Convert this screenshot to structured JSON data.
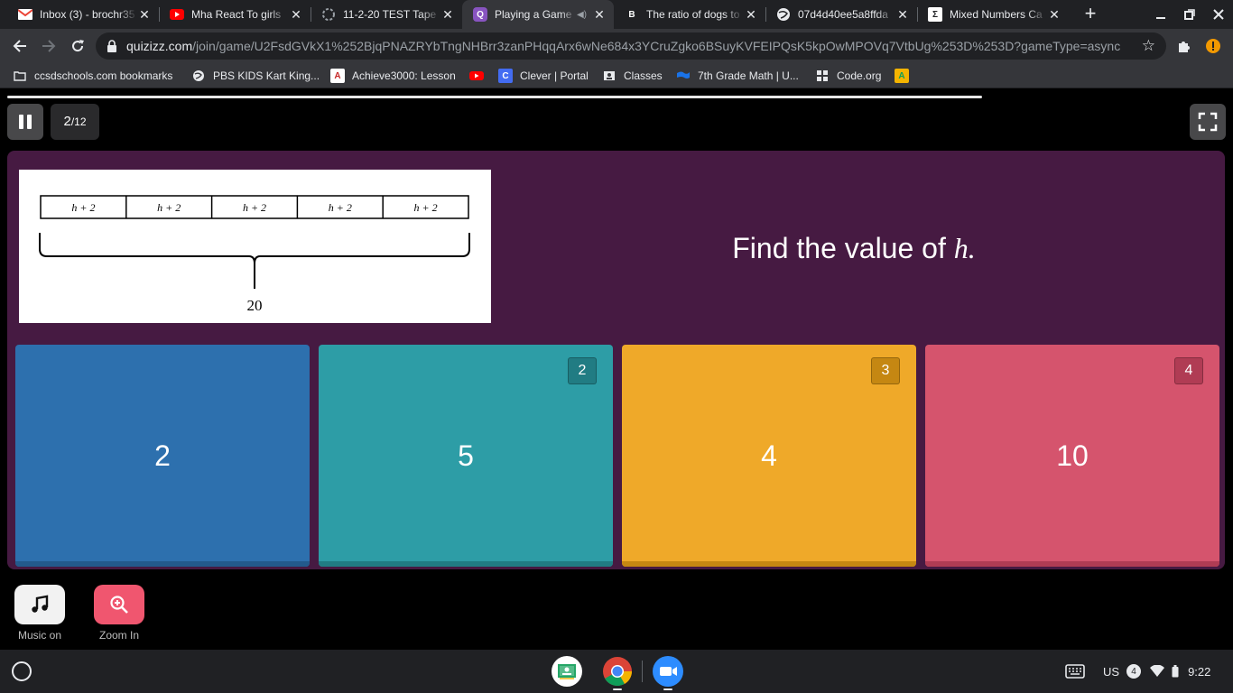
{
  "tabs": [
    {
      "title": "Inbox (3) - brochr35",
      "favicon": "gmail-icon"
    },
    {
      "title": "Mha React To girls",
      "favicon": "youtube-icon"
    },
    {
      "title": "11-2-20 TEST Tape",
      "favicon": "loading-icon"
    },
    {
      "title": "Playing a Game",
      "favicon": "quizizz-icon",
      "active": true
    },
    {
      "title": "The ratio of dogs to",
      "favicon": "brainly-icon"
    },
    {
      "title": "07d4d40ee5a8ffda",
      "favicon": "globe-icon"
    },
    {
      "title": "Mixed Numbers Ca",
      "favicon": "sigma-icon"
    }
  ],
  "address_bar": {
    "domain": "quizizz.com",
    "path": "/join/game/U2FsdGVkX1%252BjqPNAZRYbTngNHBrr3zanPHqqArx6wNe684x3YCruZgko6BSuyKVFEIPQsK5kpOwMPOVq7VtbUg%253D%253D?gameType=async"
  },
  "bookmarks": [
    {
      "label": "ccsdschools.com bookmarks",
      "icon": "folder-icon"
    },
    {
      "label": "PBS KIDS Kart King...",
      "icon": "globe-icon"
    },
    {
      "label": "Achieve3000: Lesson",
      "icon": "achieve-icon"
    },
    {
      "label": "",
      "icon": "youtube-icon"
    },
    {
      "label": "Clever | Portal",
      "icon": "clever-icon"
    },
    {
      "label": "Classes",
      "icon": "classroom-icon"
    },
    {
      "label": "7th Grade Math | U...",
      "icon": "flag-icon"
    },
    {
      "label": "Code.org",
      "icon": "codeorg-icon"
    },
    {
      "label": "",
      "icon": "app-icon"
    }
  ],
  "game": {
    "question_current": "2",
    "question_total": "/12",
    "progress_fraction": 0.8,
    "question_text": "Find the value of ",
    "question_var": "h.",
    "tape_segment_label": "h + 2",
    "tape_segments": 5,
    "tape_total": "20",
    "options": [
      {
        "value": "2",
        "num": "",
        "color": "#2d70ae",
        "shade": "#235a8c"
      },
      {
        "value": "5",
        "num": "2",
        "color": "#2d9da6",
        "shade": "#217c83"
      },
      {
        "value": "4",
        "num": "3",
        "color": "#efa929",
        "shade": "#c58712"
      },
      {
        "value": "10",
        "num": "4",
        "color": "#d5546d",
        "shade": "#b03c54"
      }
    ]
  },
  "tools": [
    {
      "label": "Music on",
      "icon": "music-note-icon"
    },
    {
      "label": "Zoom In",
      "icon": "zoom-in-icon"
    }
  ],
  "shelf": {
    "apps": [
      "classroom-app-icon",
      "chrome-app-icon",
      "zoom-app-icon"
    ],
    "locale": "US",
    "notifications": "4",
    "time": "9:22"
  }
}
